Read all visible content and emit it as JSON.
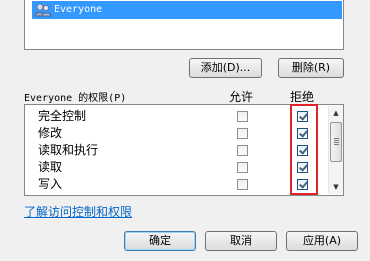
{
  "users": {
    "items": [
      {
        "name": "Everyone",
        "icon": "users-group-icon",
        "selected": true
      }
    ]
  },
  "buttons": {
    "add": "添加(D)...",
    "remove": "删除(R)",
    "ok": "确定",
    "cancel": "取消",
    "apply": "应用(A)"
  },
  "permissions": {
    "title": "Everyone 的权限(P)",
    "col_allow": "允许",
    "col_deny": "拒绝",
    "rows": [
      {
        "label": "完全控制",
        "allow": false,
        "deny": true
      },
      {
        "label": "修改",
        "allow": false,
        "deny": true
      },
      {
        "label": "读取和执行",
        "allow": false,
        "deny": true
      },
      {
        "label": "读取",
        "allow": false,
        "deny": true
      },
      {
        "label": "写入",
        "allow": false,
        "deny": true
      }
    ]
  },
  "help_link": "了解访问控制和权限",
  "colors": {
    "selection": "#3399ff",
    "highlight_box": "#e0262a",
    "link": "#0066cc"
  }
}
